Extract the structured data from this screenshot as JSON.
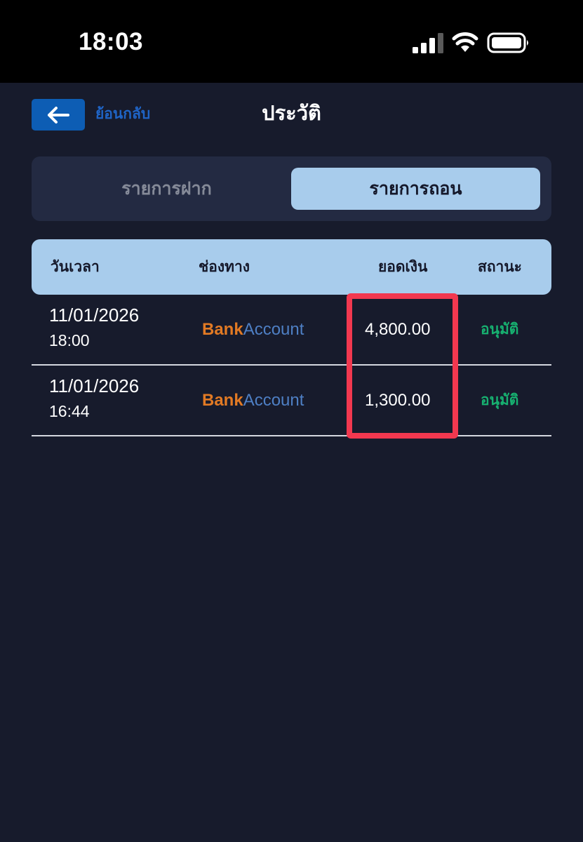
{
  "status_bar": {
    "time": "18:03",
    "icons": [
      "cellular-signal-icon",
      "wifi-icon",
      "battery-icon"
    ]
  },
  "header": {
    "back_label": "ย้อนกลับ",
    "title": "ประวัติ",
    "back_icon": "arrow-left-icon"
  },
  "tabs": [
    {
      "label": "รายการฝาก",
      "active": false
    },
    {
      "label": "รายการถอน",
      "active": true
    }
  ],
  "table": {
    "columns": [
      "วันเวลา",
      "ช่องทาง",
      "ยอดเงิน",
      "สถานะ"
    ],
    "rows": [
      {
        "date": "11/01/2026",
        "time": "18:00",
        "channel_prefix": "Bank",
        "channel_suffix": "Account",
        "amount": "4,800.00",
        "status": "อนุมัติ"
      },
      {
        "date": "11/01/2026",
        "time": "16:44",
        "channel_prefix": "Bank",
        "channel_suffix": "Account",
        "amount": "1,300.00",
        "status": "อนุมัติ"
      }
    ]
  },
  "colors": {
    "background": "#171b2c",
    "accent": "#a8ccec",
    "status_approved": "#17b070",
    "highlight": "#f2384f",
    "back_button": "#0d5db4"
  }
}
